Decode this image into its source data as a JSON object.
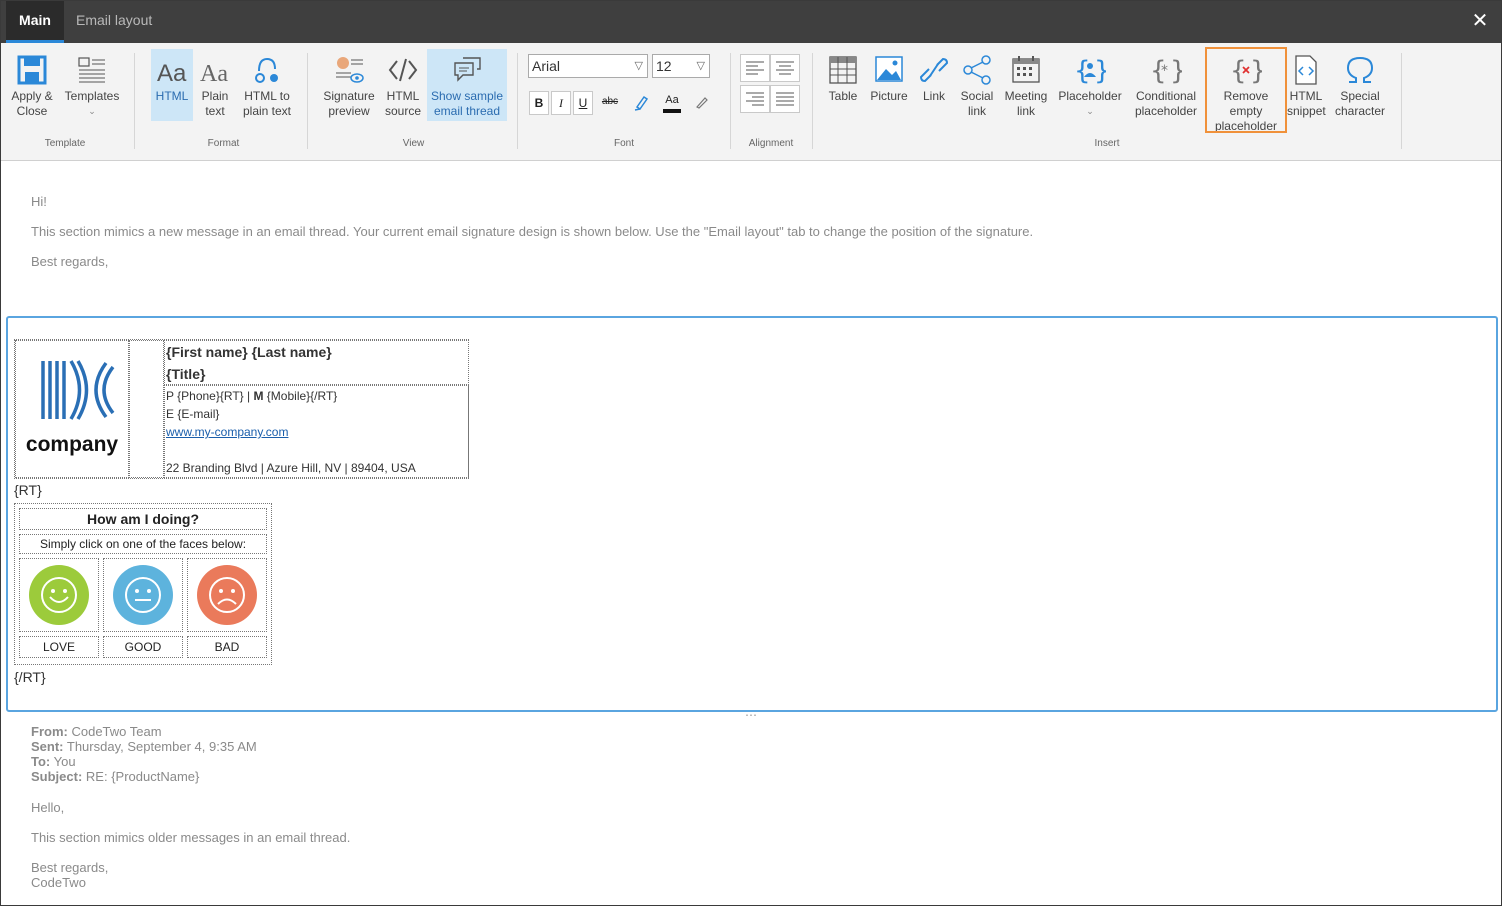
{
  "tabs": [
    {
      "label": "Main",
      "active": true
    },
    {
      "label": "Email layout",
      "active": false
    }
  ],
  "close_label": "✕",
  "ribbon": {
    "template_group": {
      "label": "Template",
      "apply_close": "Apply &\nClose",
      "templates": "Templates"
    },
    "format_group": {
      "label": "Format",
      "html": "HTML",
      "plain_text": "Plain\ntext",
      "html_to_plain": "HTML to\nplain text"
    },
    "view_group": {
      "label": "View",
      "signature_preview": "Signature\npreview",
      "html_source": "HTML\nsource",
      "show_sample": "Show sample\nemail thread"
    },
    "font_group": {
      "label": "Font",
      "font_name": "Arial",
      "font_size": "12",
      "bold": "B",
      "italic": "I",
      "underline": "U",
      "strike": "abc",
      "font_color": "Aa"
    },
    "alignment_group": {
      "label": "Alignment"
    },
    "insert_group": {
      "label": "Insert",
      "table": "Table",
      "picture": "Picture",
      "link": "Link",
      "social_link": "Social\nlink",
      "meeting_link": "Meeting\nlink",
      "placeholder": "Placeholder",
      "conditional_placeholder": "Conditional\nplaceholder",
      "remove_empty_placeholder": "Remove\nempty\nplaceholder",
      "html_snippet": "HTML\nsnippet",
      "special_character": "Special\ncharacter"
    }
  },
  "colors": {
    "titlebar": "#3f3f3f",
    "accent": "#2b88d8",
    "highlight": "#f0913a",
    "selected_button": "#cde6f7",
    "editor_border": "#5aa5e0"
  },
  "intro": {
    "greeting": "Hi!",
    "body": "This section mimics a new message in an email thread. Your current email signature design is shown below. Use the \"Email layout\" tab to change the position of the signature.",
    "closing": "Best regards,"
  },
  "signature": {
    "logo_text": "company",
    "name": "{First name} {Last name}",
    "title": "{Title}",
    "phone_prefix": "P",
    "phone": "{Phone}{RT} |",
    "mobile_prefix": "M",
    "mobile": "{Mobile}{/RT}",
    "email_prefix": "E",
    "email": "{E-mail}",
    "website": "www.my-company.com",
    "address": "22 Branding Blvd | Azure Hill, NV | 89404, USA",
    "rt_open": "{RT}",
    "rt_close": "{/RT}"
  },
  "feedback": {
    "title": "How am I doing?",
    "subtitle": "Simply click on one of the faces below:",
    "faces": [
      {
        "label": "LOVE",
        "color": "#9ccb3b"
      },
      {
        "label": "GOOD",
        "color": "#5db3dd"
      },
      {
        "label": "BAD",
        "color": "#ea7a5b"
      }
    ]
  },
  "thread": {
    "from_label": "From:",
    "from": "CodeTwo Team",
    "sent_label": "Sent:",
    "sent": "Thursday, September 4, 9:35 AM",
    "to_label": "To:",
    "to": "You",
    "subject_label": "Subject:",
    "subject": "RE: {ProductName}",
    "hello": "Hello,",
    "body": "This section mimics older messages in an email thread.",
    "closing": "Best regards,",
    "sender": "CodeTwo"
  },
  "resize_handle": "⋯"
}
